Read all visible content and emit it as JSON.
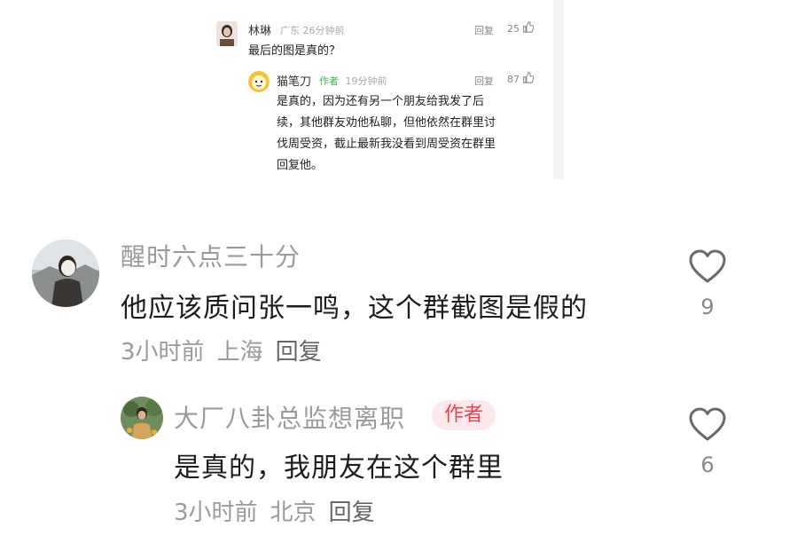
{
  "embedded_thread": {
    "comment": {
      "user": "林琳",
      "location": "广东",
      "time": "26分钟前",
      "text": "最后的图是真的？",
      "reply_label": "回复",
      "likes": "25"
    },
    "reply": {
      "user": "猫笔刀",
      "author_tag": "作者",
      "time": "19分钟前",
      "text_lines": [
        "是真的，因为还有另一个朋友给我发了后",
        "续，其他群友劝他私聊，但他依然在群里讨",
        "伐周受资，截止最新我没看到周受资在群里",
        "回复他。"
      ],
      "reply_label": "回复",
      "likes": "87"
    }
  },
  "comments": [
    {
      "user": "醒时六点三十分",
      "text": "他应该质问张一鸣，这个群截图是假的",
      "time": "3小时前",
      "location": "上海",
      "reply_label": "回复",
      "likes": "9"
    },
    {
      "user": "大厂八卦总监想离职",
      "author_tag": "作者",
      "text": "是真的，我朋友在这个群里",
      "time": "3小时前",
      "location": "北京",
      "reply_label": "回复",
      "likes": "6"
    }
  ],
  "icons": {
    "like": "heart-outline-icon",
    "small_like": "thumb-up-icon"
  },
  "colors": {
    "author_badge_text": "#e8414f",
    "author_badge_bg": "#fde9eb",
    "small_author_tag": "#3ab54a",
    "muted_text": "#9a9a9a"
  }
}
